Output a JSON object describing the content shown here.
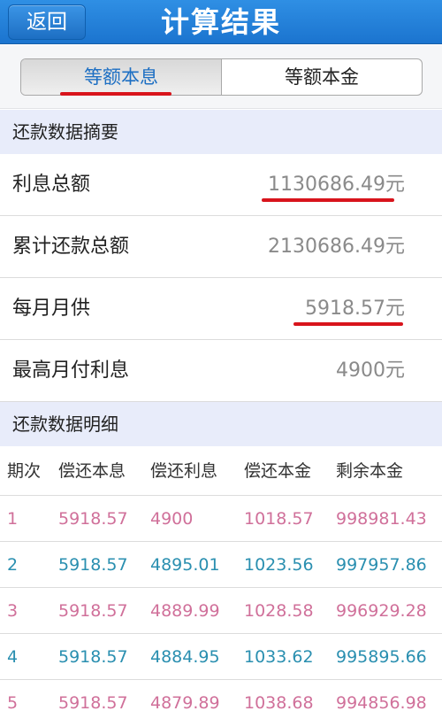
{
  "navbar": {
    "back_label": "返回",
    "title": "计算结果"
  },
  "segment": {
    "tabs": [
      "等额本息",
      "等额本金"
    ],
    "active": 0
  },
  "summary": {
    "header": "还款数据摘要",
    "rows": [
      {
        "label": "利息总额",
        "value": "1130686.49元"
      },
      {
        "label": "累计还款总额",
        "value": "2130686.49元"
      },
      {
        "label": "每月月供",
        "value": "5918.57元"
      },
      {
        "label": "最高月付利息",
        "value": "4900元"
      }
    ]
  },
  "detail": {
    "header": "还款数据明细",
    "columns": [
      "期次",
      "偿还本息",
      "偿还利息",
      "偿还本金",
      "剩余本金"
    ],
    "rows": [
      [
        "1",
        "5918.57",
        "4900",
        "1018.57",
        "998981.43"
      ],
      [
        "2",
        "5918.57",
        "4895.01",
        "1023.56",
        "997957.86"
      ],
      [
        "3",
        "5918.57",
        "4889.99",
        "1028.58",
        "996929.28"
      ],
      [
        "4",
        "5918.57",
        "4884.95",
        "1033.62",
        "995895.66"
      ],
      [
        "5",
        "5918.57",
        "4879.89",
        "1038.68",
        "994856.98"
      ]
    ]
  },
  "colors": {
    "navbar": "#1b74cf",
    "section_header_bg": "#e8ecfa",
    "row_odd": "#d0709a",
    "row_even": "#2a8fb0",
    "annotation": "#d8141c"
  }
}
